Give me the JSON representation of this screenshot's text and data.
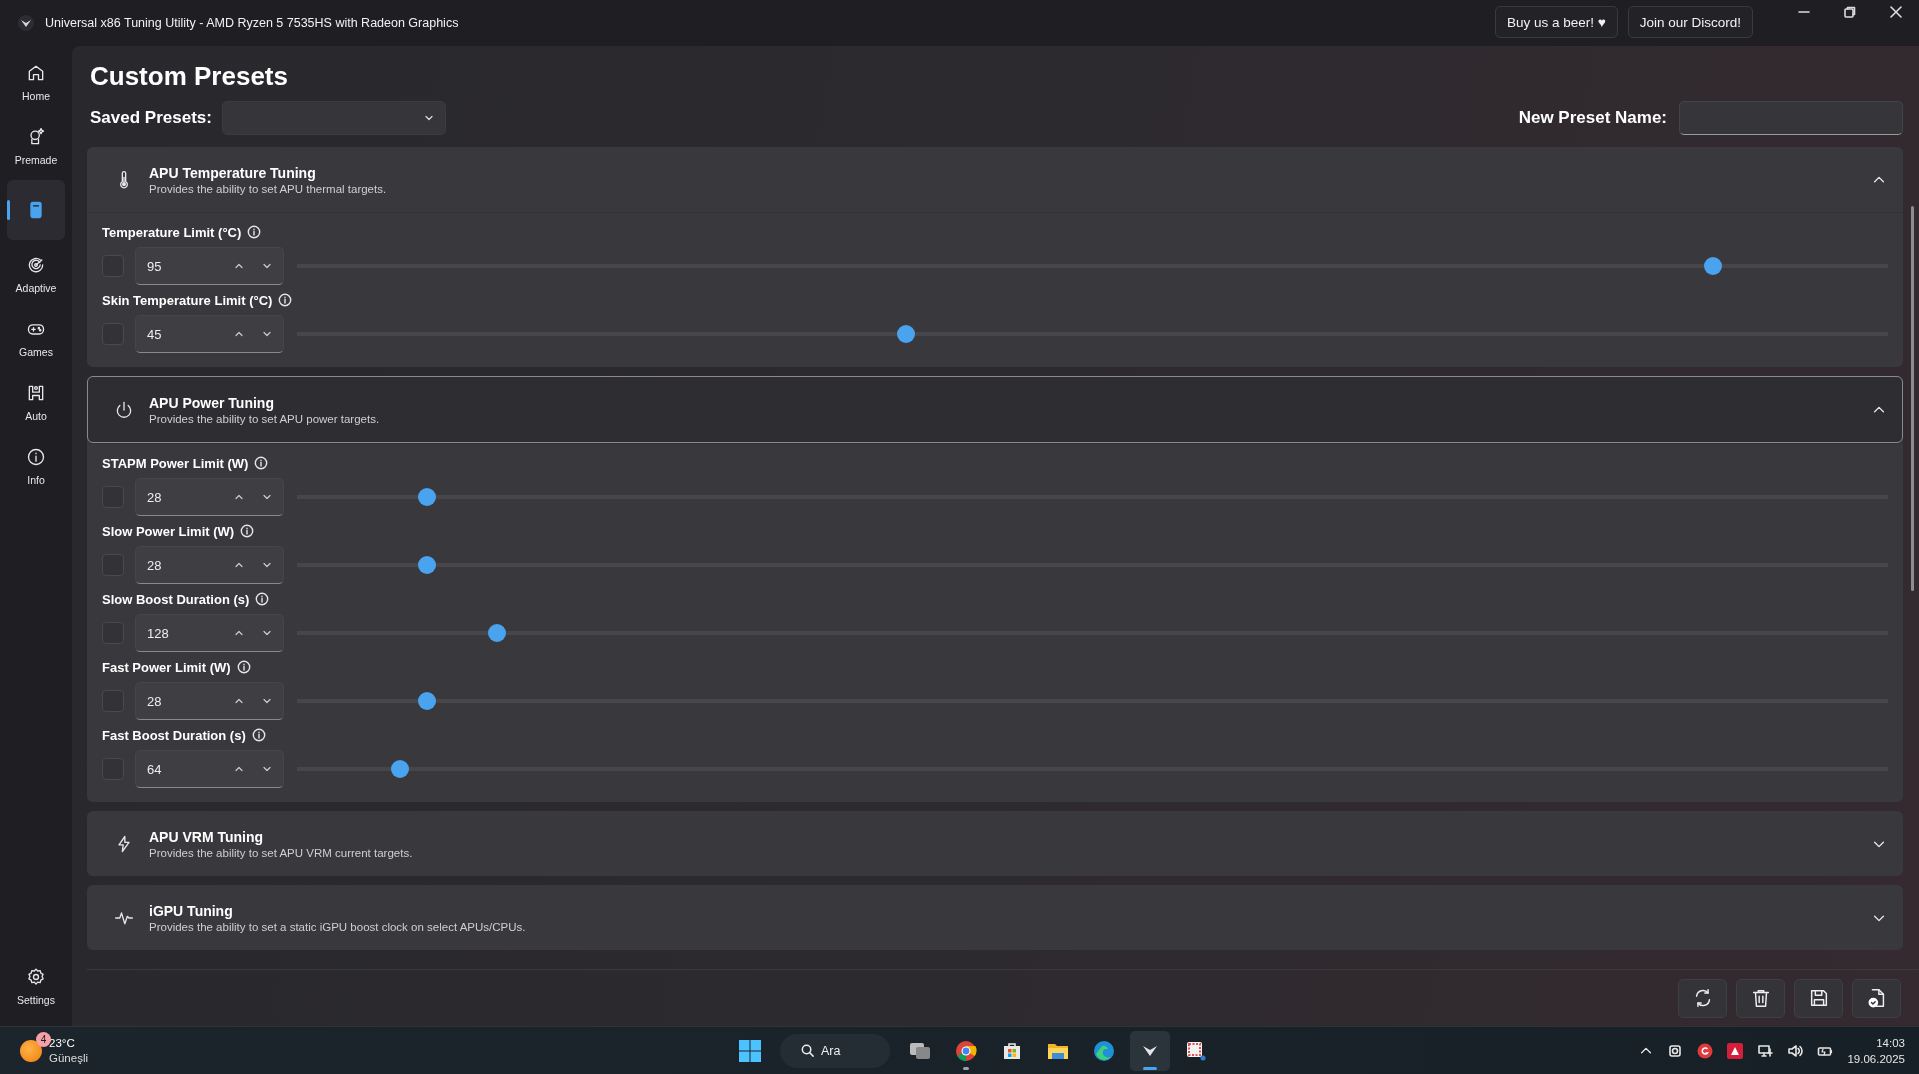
{
  "window": {
    "title": "Universal x86 Tuning Utility - AMD Ryzen 5 7535HS with Radeon Graphics"
  },
  "header_buttons": [
    {
      "label": "Buy us a beer! ♥"
    },
    {
      "label": "Join our Discord!"
    }
  ],
  "sidebar": {
    "items": [
      {
        "kind": "home",
        "label": "Home",
        "selected": false
      },
      {
        "kind": "premade",
        "label": "Premade",
        "selected": false
      },
      {
        "kind": "custom",
        "selected": true
      },
      {
        "kind": "adaptive",
        "label": "Adaptive",
        "selected": false
      },
      {
        "kind": "games",
        "label": "Games",
        "selected": false
      },
      {
        "kind": "auto",
        "label": "Auto",
        "selected": false
      },
      {
        "kind": "info",
        "label": "Info",
        "selected": false
      }
    ],
    "footer": {
      "kind": "settings",
      "label": "Settings",
      "selected": false
    }
  },
  "page": {
    "title": "Custom Presets",
    "saved_presets_label": "Saved Presets:",
    "new_preset_label": "New Preset Name:"
  },
  "sections": [
    {
      "kind": "thermometer",
      "title": "APU Temperature Tuning",
      "description": "Provides the ability to set APU thermal targets.",
      "expanded": true,
      "focused": false,
      "settings": [
        {
          "label": "Temperature Limit (°C)",
          "enabled": false,
          "value": "95",
          "level": 0.89
        },
        {
          "label": "Skin Temperature Limit (°C)",
          "enabled": false,
          "value": "45",
          "level": 0.383
        }
      ]
    },
    {
      "kind": "power",
      "title": "APU Power Tuning",
      "description": "Provides the ability to set APU power targets.",
      "expanded": true,
      "focused": true,
      "settings": [
        {
          "label": "STAPM Power Limit (W)",
          "enabled": false,
          "value": "28",
          "level": 0.082
        },
        {
          "label": "Slow Power Limit (W)",
          "enabled": false,
          "value": "28",
          "level": 0.082
        },
        {
          "label": "Slow Boost Duration (s)",
          "enabled": false,
          "value": "128",
          "level": 0.126
        },
        {
          "label": "Fast Power Limit (W)",
          "enabled": false,
          "value": "28",
          "level": 0.082
        },
        {
          "label": "Fast Boost Duration (s)",
          "enabled": false,
          "value": "64",
          "level": 0.065
        }
      ]
    },
    {
      "kind": "bolt",
      "title": "APU VRM Tuning",
      "description": "Provides the ability to set APU VRM current targets.",
      "expanded": false,
      "focused": false
    },
    {
      "kind": "pulse",
      "title": "iGPU Tuning",
      "description": "Provides the ability to set a static iGPU boost clock on select APUs/CPUs.",
      "expanded": false,
      "focused": false
    }
  ],
  "actions": [
    {
      "kind": "reload"
    },
    {
      "kind": "delete"
    },
    {
      "kind": "save"
    },
    {
      "kind": "apply"
    }
  ],
  "taskbar": {
    "weather": {
      "badge": "4",
      "temperature": "23°C",
      "condition": "Güneşli"
    },
    "search": {
      "label": "Ara"
    },
    "apps": [
      {
        "kind": "taskview",
        "running": false,
        "selected": false
      },
      {
        "kind": "chrome",
        "running": true,
        "selected": false
      },
      {
        "kind": "store",
        "running": false,
        "selected": false
      },
      {
        "kind": "files",
        "running": false,
        "selected": false
      },
      {
        "kind": "edge",
        "running": false,
        "selected": false
      },
      {
        "kind": "uxtu",
        "running": true,
        "selected": true
      },
      {
        "kind": "snip",
        "running": false,
        "selected": false
      }
    ],
    "clock": {
      "time": "14:03",
      "date": "19.06.2025"
    }
  }
}
